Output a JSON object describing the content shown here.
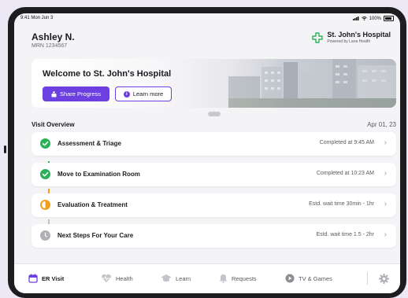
{
  "status_bar": {
    "time": "9:41 Mon Jun 3",
    "battery": "100%"
  },
  "patient": {
    "name": "Ashley N.",
    "mrn": "MRN 1234567"
  },
  "hospital": {
    "name": "St. John's Hospital",
    "tagline": "Powered by Lana Health"
  },
  "banner": {
    "welcome": "Welcome to St. John's Hospital",
    "share_label": "Share Progress",
    "learn_label": "Learn more"
  },
  "visit": {
    "title": "Visit Overview",
    "date": "Apr 01, 23",
    "steps": [
      {
        "label": "Assessment & Triage",
        "status": "Completed at 9:45 AM",
        "state": "done"
      },
      {
        "label": "Move to Examination Room",
        "status": "Completed at 10:23 AM",
        "state": "done"
      },
      {
        "label": "Evaluation & Treatment",
        "status": "Estd. wait time 30min - 1hr",
        "state": "in-progress"
      },
      {
        "label": "Next Steps For Your Care",
        "status": "Estd. wait time 1.5 - 2hr",
        "state": "pending"
      }
    ]
  },
  "tabs": [
    {
      "label": "ER Visit",
      "icon": "calendar-icon",
      "active": true
    },
    {
      "label": "Health",
      "icon": "heart-pulse-icon",
      "active": false
    },
    {
      "label": "Learn",
      "icon": "graduation-cap-icon",
      "active": false
    },
    {
      "label": "Requests",
      "icon": "bell-icon",
      "active": false
    },
    {
      "label": "TV & Games",
      "icon": "play-icon",
      "active": false
    }
  ],
  "colors": {
    "accent": "#6c3fe0",
    "done": "#2bb157",
    "in_progress": "#f0a020",
    "pending": "#b0b0b5"
  }
}
